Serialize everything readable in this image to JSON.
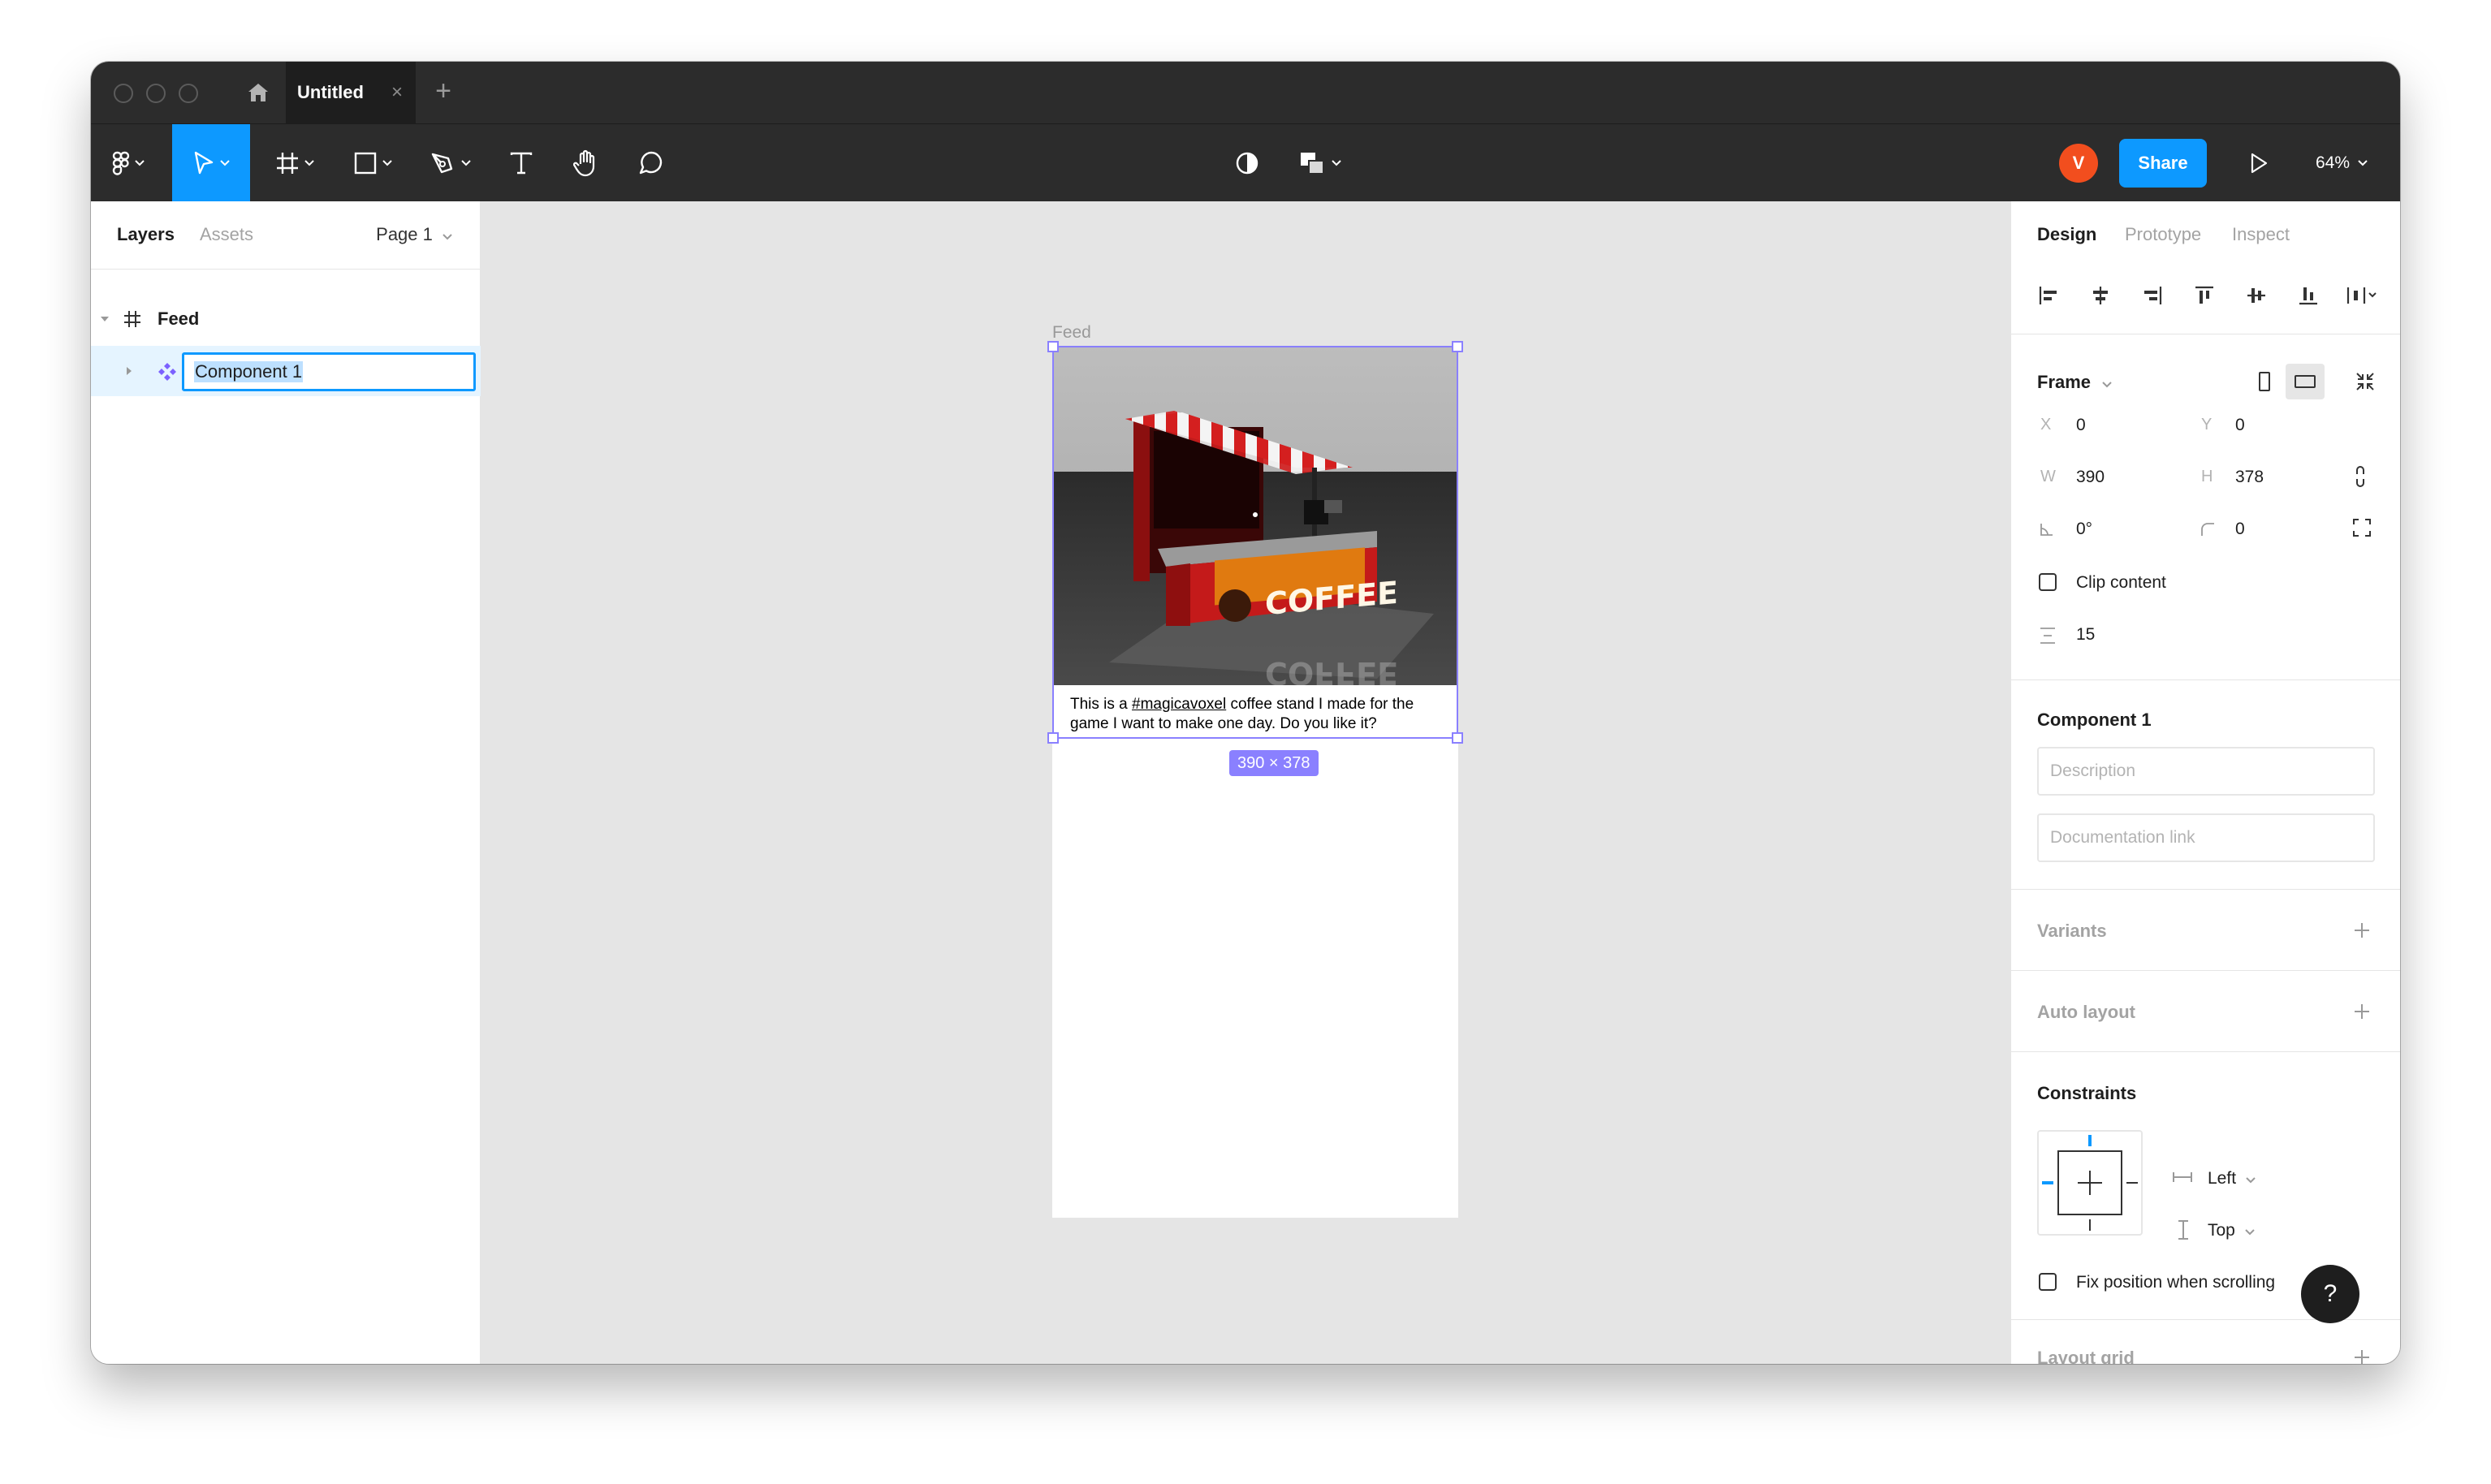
{
  "titlebar": {
    "tab_title": "Untitled",
    "tab_close": "×",
    "tab_add": "+"
  },
  "toolbar": {
    "avatar_initial": "V",
    "share_label": "Share",
    "zoom_label": "64%"
  },
  "left_panel": {
    "tabs": [
      "Layers",
      "Assets"
    ],
    "page_selector": "Page 1",
    "layers": [
      {
        "name": "Feed",
        "type": "frame"
      },
      {
        "name": "Component 1",
        "type": "component",
        "editing": true
      }
    ]
  },
  "canvas": {
    "frame_label": "Feed",
    "post": {
      "text_prefix": "This is a ",
      "hashtag": "#magicavoxel",
      "text_suffix": " coffee stand I made for the game I want to make one day. Do you like it?",
      "image_sign": "COFFEE"
    },
    "selection_size": "390 × 378"
  },
  "right_panel": {
    "tabs": [
      "Design",
      "Prototype",
      "Inspect"
    ],
    "frame": {
      "title": "Frame",
      "x_label": "X",
      "x": "0",
      "y_label": "Y",
      "y": "0",
      "w_label": "W",
      "w": "390",
      "h_label": "H",
      "h": "378",
      "rotation": "0°",
      "radius": "0",
      "clip_content": "Clip content",
      "spacing": "15"
    },
    "component": {
      "title": "Component 1",
      "description_placeholder": "Description",
      "doc_link_placeholder": "Documentation link"
    },
    "variants": "Variants",
    "auto_layout": "Auto layout",
    "constraints": {
      "title": "Constraints",
      "horizontal": "Left",
      "vertical": "Top",
      "fix_position": "Fix position when scrolling"
    },
    "layout_grid": "Layout grid",
    "help": "?"
  },
  "colors": {
    "accent": "#0d99ff",
    "selection": "#8a80ff",
    "component": "#7b61ff",
    "avatar": "#f24e1e"
  }
}
